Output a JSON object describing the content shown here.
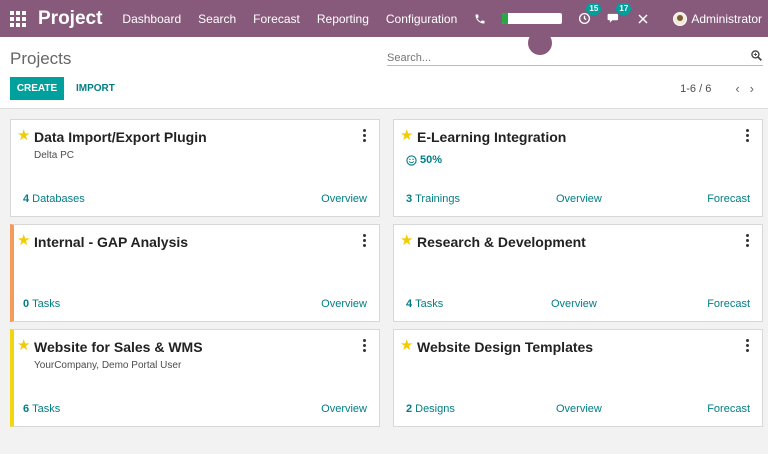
{
  "navbar": {
    "app_name": "Project",
    "menu": [
      "Dashboard",
      "Search",
      "Forecast",
      "Reporting",
      "Configuration"
    ],
    "activity_badge": "15",
    "messages_badge": "17",
    "progress_fraction": 0.1,
    "user_name": "Administrator"
  },
  "control": {
    "title": "Projects",
    "search_placeholder": "Search...",
    "create_label": "CREATE",
    "import_label": "IMPORT",
    "pager_value": "1-6 / 6",
    "prev_icon": "‹",
    "next_icon": "›"
  },
  "colors": {
    "brand": "#875a7b",
    "primary": "#00a09d",
    "link": "#017e84",
    "star": "#f3cc00",
    "accent_orange": "#f49a5a",
    "accent_yellow": "#f4d60f"
  },
  "cards": [
    {
      "title": "Data Import/Export Plugin",
      "subtitle": "Delta PC",
      "stat_count": "4",
      "stat_label": "Databases",
      "overview": "Overview",
      "forecast": ""
    },
    {
      "title": "E-Learning Integration",
      "rating": "50%",
      "stat_count": "3",
      "stat_label": "Trainings",
      "overview": "Overview",
      "forecast": "Forecast"
    },
    {
      "title": "Internal - GAP Analysis",
      "stat_count": "0",
      "stat_label": "Tasks",
      "overview": "Overview",
      "forecast": ""
    },
    {
      "title": "Research & Development",
      "stat_count": "4",
      "stat_label": "Tasks",
      "overview": "Overview",
      "forecast": "Forecast"
    },
    {
      "title": "Website for Sales & WMS",
      "subtitle": "YourCompany, Demo Portal User",
      "stat_count": "6",
      "stat_label": "Tasks",
      "overview": "Overview",
      "forecast": ""
    },
    {
      "title": "Website Design Templates",
      "stat_count": "2",
      "stat_label": "Designs",
      "overview": "Overview",
      "forecast": "Forecast"
    }
  ]
}
